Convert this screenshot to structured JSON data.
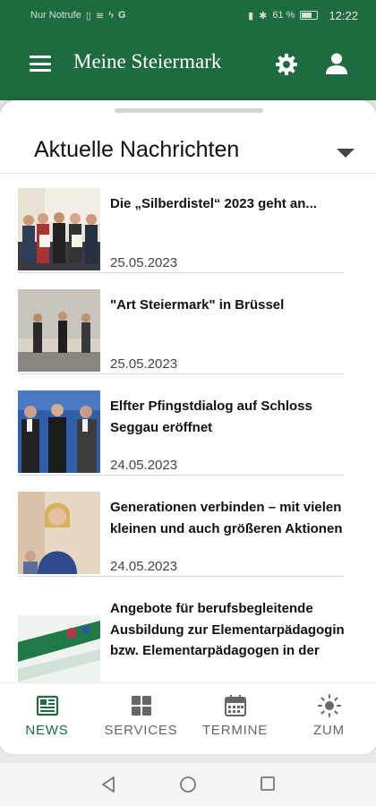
{
  "status_bar": {
    "carrier": "Nur Notrufe",
    "battery": "61 %",
    "time": "12:22"
  },
  "app_bar": {
    "title": "Meine Steiermark",
    "icons": [
      "menu-icon",
      "gear-icon",
      "user-icon"
    ]
  },
  "section": {
    "title": "Aktuelle Nachrichten"
  },
  "news": [
    {
      "title": "Die „Silberdistel“ 2023 geht an...",
      "date": "25.05.2023"
    },
    {
      "title": "\"Art Steiermark\" in Brüssel",
      "date": "25.05.2023"
    },
    {
      "title": "Elfter Pfingstdialog auf Schloss Seggau eröffnet",
      "date": "24.05.2023"
    },
    {
      "title": "Generationen verbinden – mit vielen kleinen und auch größeren Aktionen",
      "date": "24.05.2023"
    },
    {
      "title": "Angebote für berufsbegleitende Ausbildung zur Elementarpädagogin bzw. Elementarpädagogen in der",
      "date": ""
    }
  ],
  "bottom_nav": [
    {
      "label": "NEWS",
      "icon": "news-icon",
      "active": true
    },
    {
      "label": "SERVICES",
      "icon": "grid-icon",
      "active": false
    },
    {
      "label": "TERMINE",
      "icon": "calendar-icon",
      "active": false
    },
    {
      "label": "ZUM",
      "icon": "sun-icon",
      "active": false
    }
  ],
  "colors": {
    "brand_green": "#1e6b40",
    "active_nav": "#1e6b40",
    "inactive_nav": "#666666"
  }
}
